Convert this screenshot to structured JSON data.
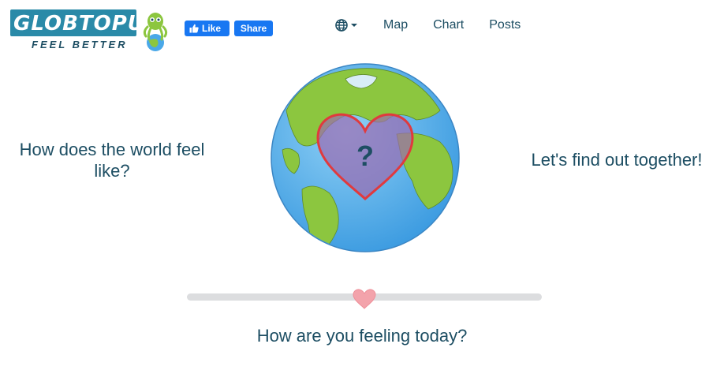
{
  "brand": {
    "name": "GLOBTOPUS",
    "tagline": "FEEL BETTER"
  },
  "social": {
    "like_label": "Like",
    "share_label": "Share"
  },
  "nav": {
    "globe_icon": "globe-icon",
    "links": [
      {
        "label": "Map"
      },
      {
        "label": "Chart"
      },
      {
        "label": "Posts"
      }
    ]
  },
  "hero": {
    "left_heading": "How does the world feel like?",
    "right_heading": "Let's find out together!",
    "globe_mark": "?"
  },
  "feeling": {
    "level": 0.5,
    "prompt": "How are you feeling today?"
  },
  "colors": {
    "text": "#1d4e63",
    "facebook": "#1877f2",
    "heart": "#e03a3e",
    "ocean": "#4aa8e8",
    "land": "#8cc63f"
  }
}
